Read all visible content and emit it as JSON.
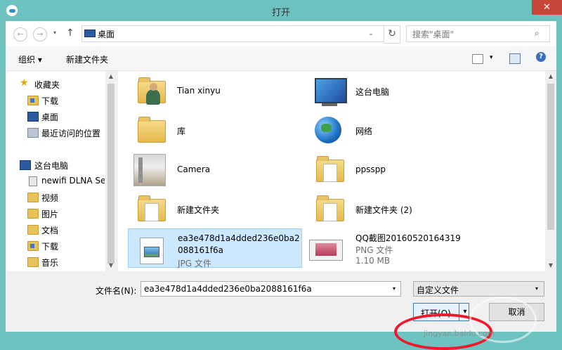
{
  "window": {
    "title": "打开",
    "close_label": "✕"
  },
  "nav": {
    "back": "←",
    "forward": "→",
    "recent_dd": "▾",
    "up": "↑",
    "address": "桌面",
    "address_dd": "⌄",
    "refresh": "↻",
    "search_placeholder": "搜索\"桌面\"",
    "search_icon": "search-icon"
  },
  "toolbar": {
    "organize": "组织 ▾",
    "new_folder": "新建文件夹",
    "view_dd": "▾",
    "help": "?"
  },
  "sidebar": {
    "up_arrow": "▲",
    "down_arrow": "▼",
    "items": [
      {
        "label": "收藏夹",
        "icon": "star-icon"
      },
      {
        "label": "下载",
        "icon": "download-folder-icon"
      },
      {
        "label": "桌面",
        "icon": "desktop-icon"
      },
      {
        "label": "最近访问的位置",
        "icon": "recent-places-icon"
      },
      {
        "label": "这台电脑",
        "icon": "computer-icon"
      },
      {
        "label": "newifi DLNA Se",
        "icon": "media-device-icon"
      },
      {
        "label": "视频",
        "icon": "videos-folder-icon"
      },
      {
        "label": "图片",
        "icon": "pictures-folder-icon"
      },
      {
        "label": "文档",
        "icon": "documents-folder-icon"
      },
      {
        "label": "下载",
        "icon": "download-folder-icon"
      },
      {
        "label": "音乐",
        "icon": "music-folder-icon"
      }
    ]
  },
  "files": [
    {
      "name": "Tian xinyu",
      "icon": "user-folder-icon"
    },
    {
      "name": "这台电脑",
      "icon": "computer-icon"
    },
    {
      "name": "库",
      "icon": "libraries-icon"
    },
    {
      "name": "网络",
      "icon": "network-icon"
    },
    {
      "name": "Camera",
      "icon": "camera-folder-icon"
    },
    {
      "name": "ppsspp",
      "icon": "folder-icon"
    },
    {
      "name": "新建文件夹",
      "icon": "folder-icon"
    },
    {
      "name": "新建文件夹 (2)",
      "icon": "folder-icon"
    },
    {
      "name": "ea3e478d1a4dded236e0ba2088161f6a",
      "type": "JPG 文件",
      "icon": "jpg-file-icon",
      "selected": true
    },
    {
      "name": "QQ截图20160520164319",
      "type": "PNG 文件",
      "size": "1.10 MB",
      "icon": "png-thumbnail"
    }
  ],
  "bottom": {
    "filename_label": "文件名(N):",
    "filename_value": "ea3e478d1a4dded236e0ba2088161f6a",
    "filetype_value": "自定义文件",
    "open_label": "打开(O)",
    "cancel_label": "取消",
    "dd": "▾"
  },
  "watermark": "jingyan.baidu.com",
  "colors": {
    "accent": "#6ec3c1",
    "selection": "#cce8ff",
    "annotation": "#ee1a2c",
    "close": "#c7463a"
  }
}
